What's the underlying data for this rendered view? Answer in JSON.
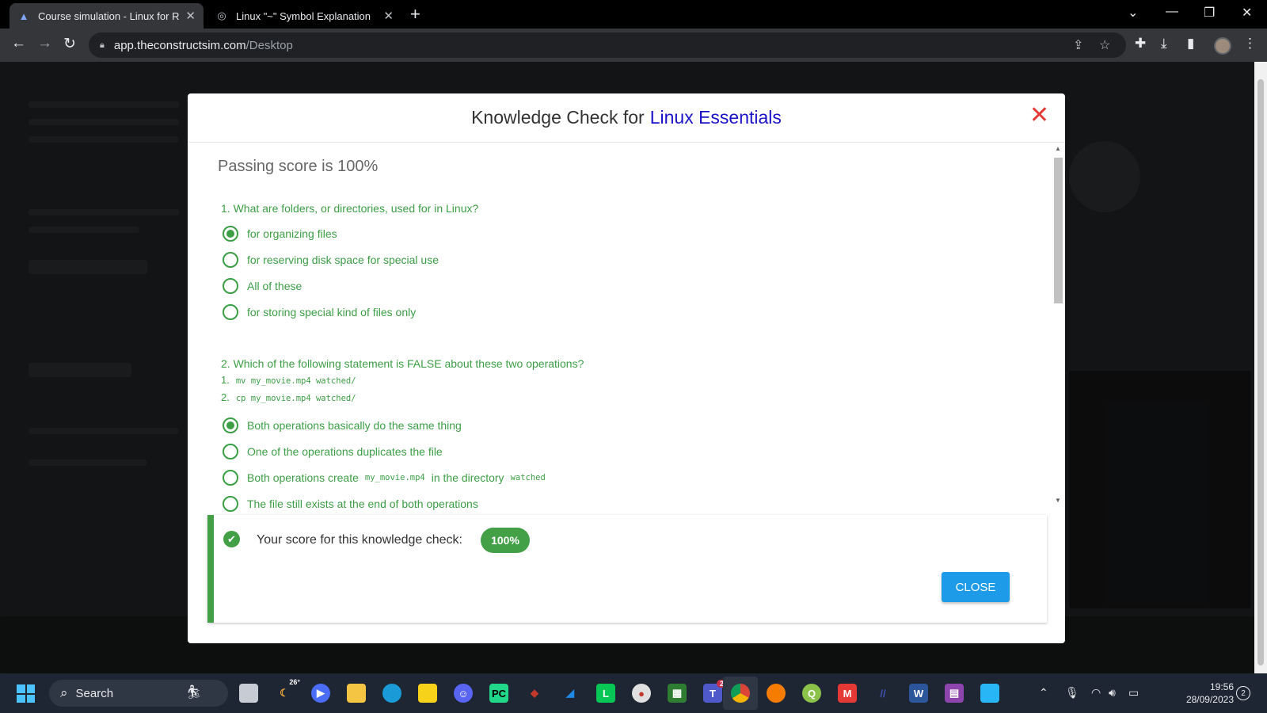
{
  "browser": {
    "tabs": [
      {
        "title": "Course simulation - Linux for Ro",
        "active": true
      },
      {
        "title": "Linux \"~\" Symbol Explanation",
        "active": false
      }
    ],
    "url_host": "app.theconstructsim.com",
    "url_path": "/Desktop"
  },
  "modal": {
    "title_prefix": "Knowledge Check for",
    "title_highlight": "Linux Essentials",
    "passing_score": "Passing score is 100%",
    "q1": {
      "question": "1. What are folders, or directories, used for in Linux?",
      "options": [
        {
          "label": "for organizing files",
          "selected": true
        },
        {
          "label": "for reserving disk space for special use",
          "selected": false
        },
        {
          "label": "All of these",
          "selected": false
        },
        {
          "label": "for storing special kind of files only",
          "selected": false
        }
      ]
    },
    "q2": {
      "question": "2. Which of the following statement is FALSE about these two operations?",
      "code1_num": "1.",
      "code1": "mv my_movie.mp4 watched/",
      "code2_num": "2.",
      "code2": "cp my_movie.mp4 watched/",
      "options": [
        {
          "label": "Both operations basically do the same thing",
          "selected": true
        },
        {
          "label": "One of the operations duplicates the file",
          "selected": false
        },
        {
          "label_pre": "Both operations create",
          "code_a": "my_movie.mp4",
          "label_mid": "in the directory",
          "code_b": "watched",
          "selected": false
        },
        {
          "label": "The file still exists at the end of both operations",
          "selected": false
        }
      ]
    },
    "result": {
      "text": "Your score for this knowledge check:",
      "score": "100%",
      "close_label": "CLOSE"
    }
  },
  "taskbar": {
    "search_label": "Search",
    "weather_temp": "26°",
    "teams_badge": "2",
    "time": "19:56",
    "date": "28/09/2023",
    "notifications": "2"
  },
  "colors": {
    "accent_green": "#3c9e45",
    "title_blue": "#1a12c8",
    "close_red": "#e53935",
    "button_blue": "#1e9be8"
  }
}
